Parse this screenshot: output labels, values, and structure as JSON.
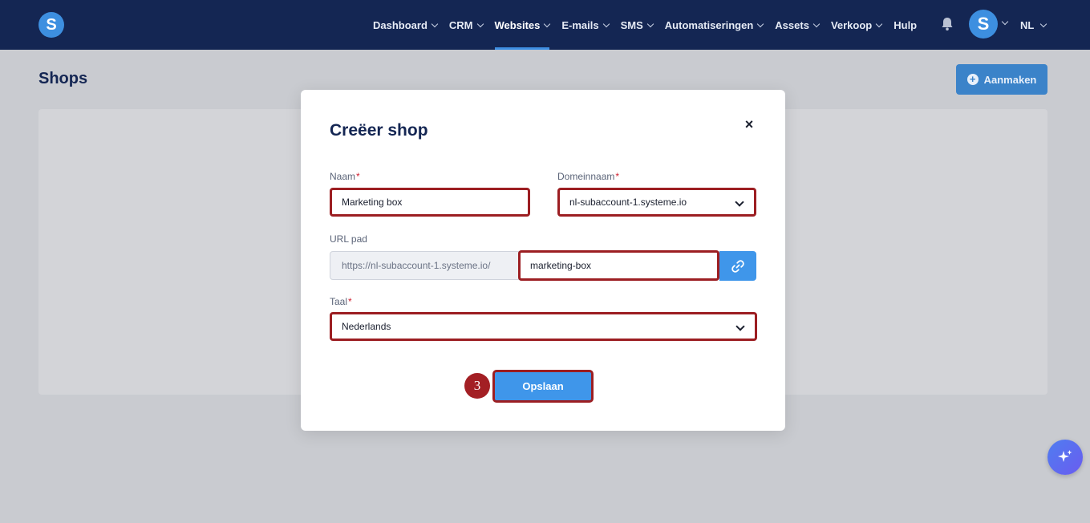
{
  "app": {
    "logo_letter": "S"
  },
  "nav": {
    "items": [
      {
        "label": "Dashboard",
        "has_dropdown": true,
        "active": false
      },
      {
        "label": "CRM",
        "has_dropdown": true,
        "active": false
      },
      {
        "label": "Websites",
        "has_dropdown": true,
        "active": true
      },
      {
        "label": "E-mails",
        "has_dropdown": true,
        "active": false
      },
      {
        "label": "SMS",
        "has_dropdown": true,
        "active": false
      },
      {
        "label": "Automatiseringen",
        "has_dropdown": true,
        "active": false
      },
      {
        "label": "Assets",
        "has_dropdown": true,
        "active": false
      },
      {
        "label": "Verkoop",
        "has_dropdown": true,
        "active": false
      },
      {
        "label": "Hulp",
        "has_dropdown": false,
        "active": false
      }
    ],
    "avatar_letter": "S",
    "language": "NL",
    "icons": [
      "bell-icon",
      "chevron-down-icon"
    ]
  },
  "page": {
    "title": "Shops",
    "create_label": "Aanmaken"
  },
  "modal": {
    "title": "Creëer shop",
    "close_symbol": "×",
    "name": {
      "label": "Naam",
      "required": "*",
      "value": "Marketing box"
    },
    "domain": {
      "label": "Domeinnaam",
      "required": "*",
      "value": "nl-subaccount-1.systeme.io"
    },
    "url": {
      "label": "URL pad",
      "prefix": "https://nl-subaccount-1.systeme.io/",
      "value": "marketing-box"
    },
    "language": {
      "label": "Taal",
      "required": "*",
      "value": "Nederlands"
    },
    "save_label": "Opslaan",
    "step_number": "3"
  },
  "colors": {
    "navbar": "#142653",
    "accent": "#3f96ea",
    "highlight": "#9c1e22"
  }
}
